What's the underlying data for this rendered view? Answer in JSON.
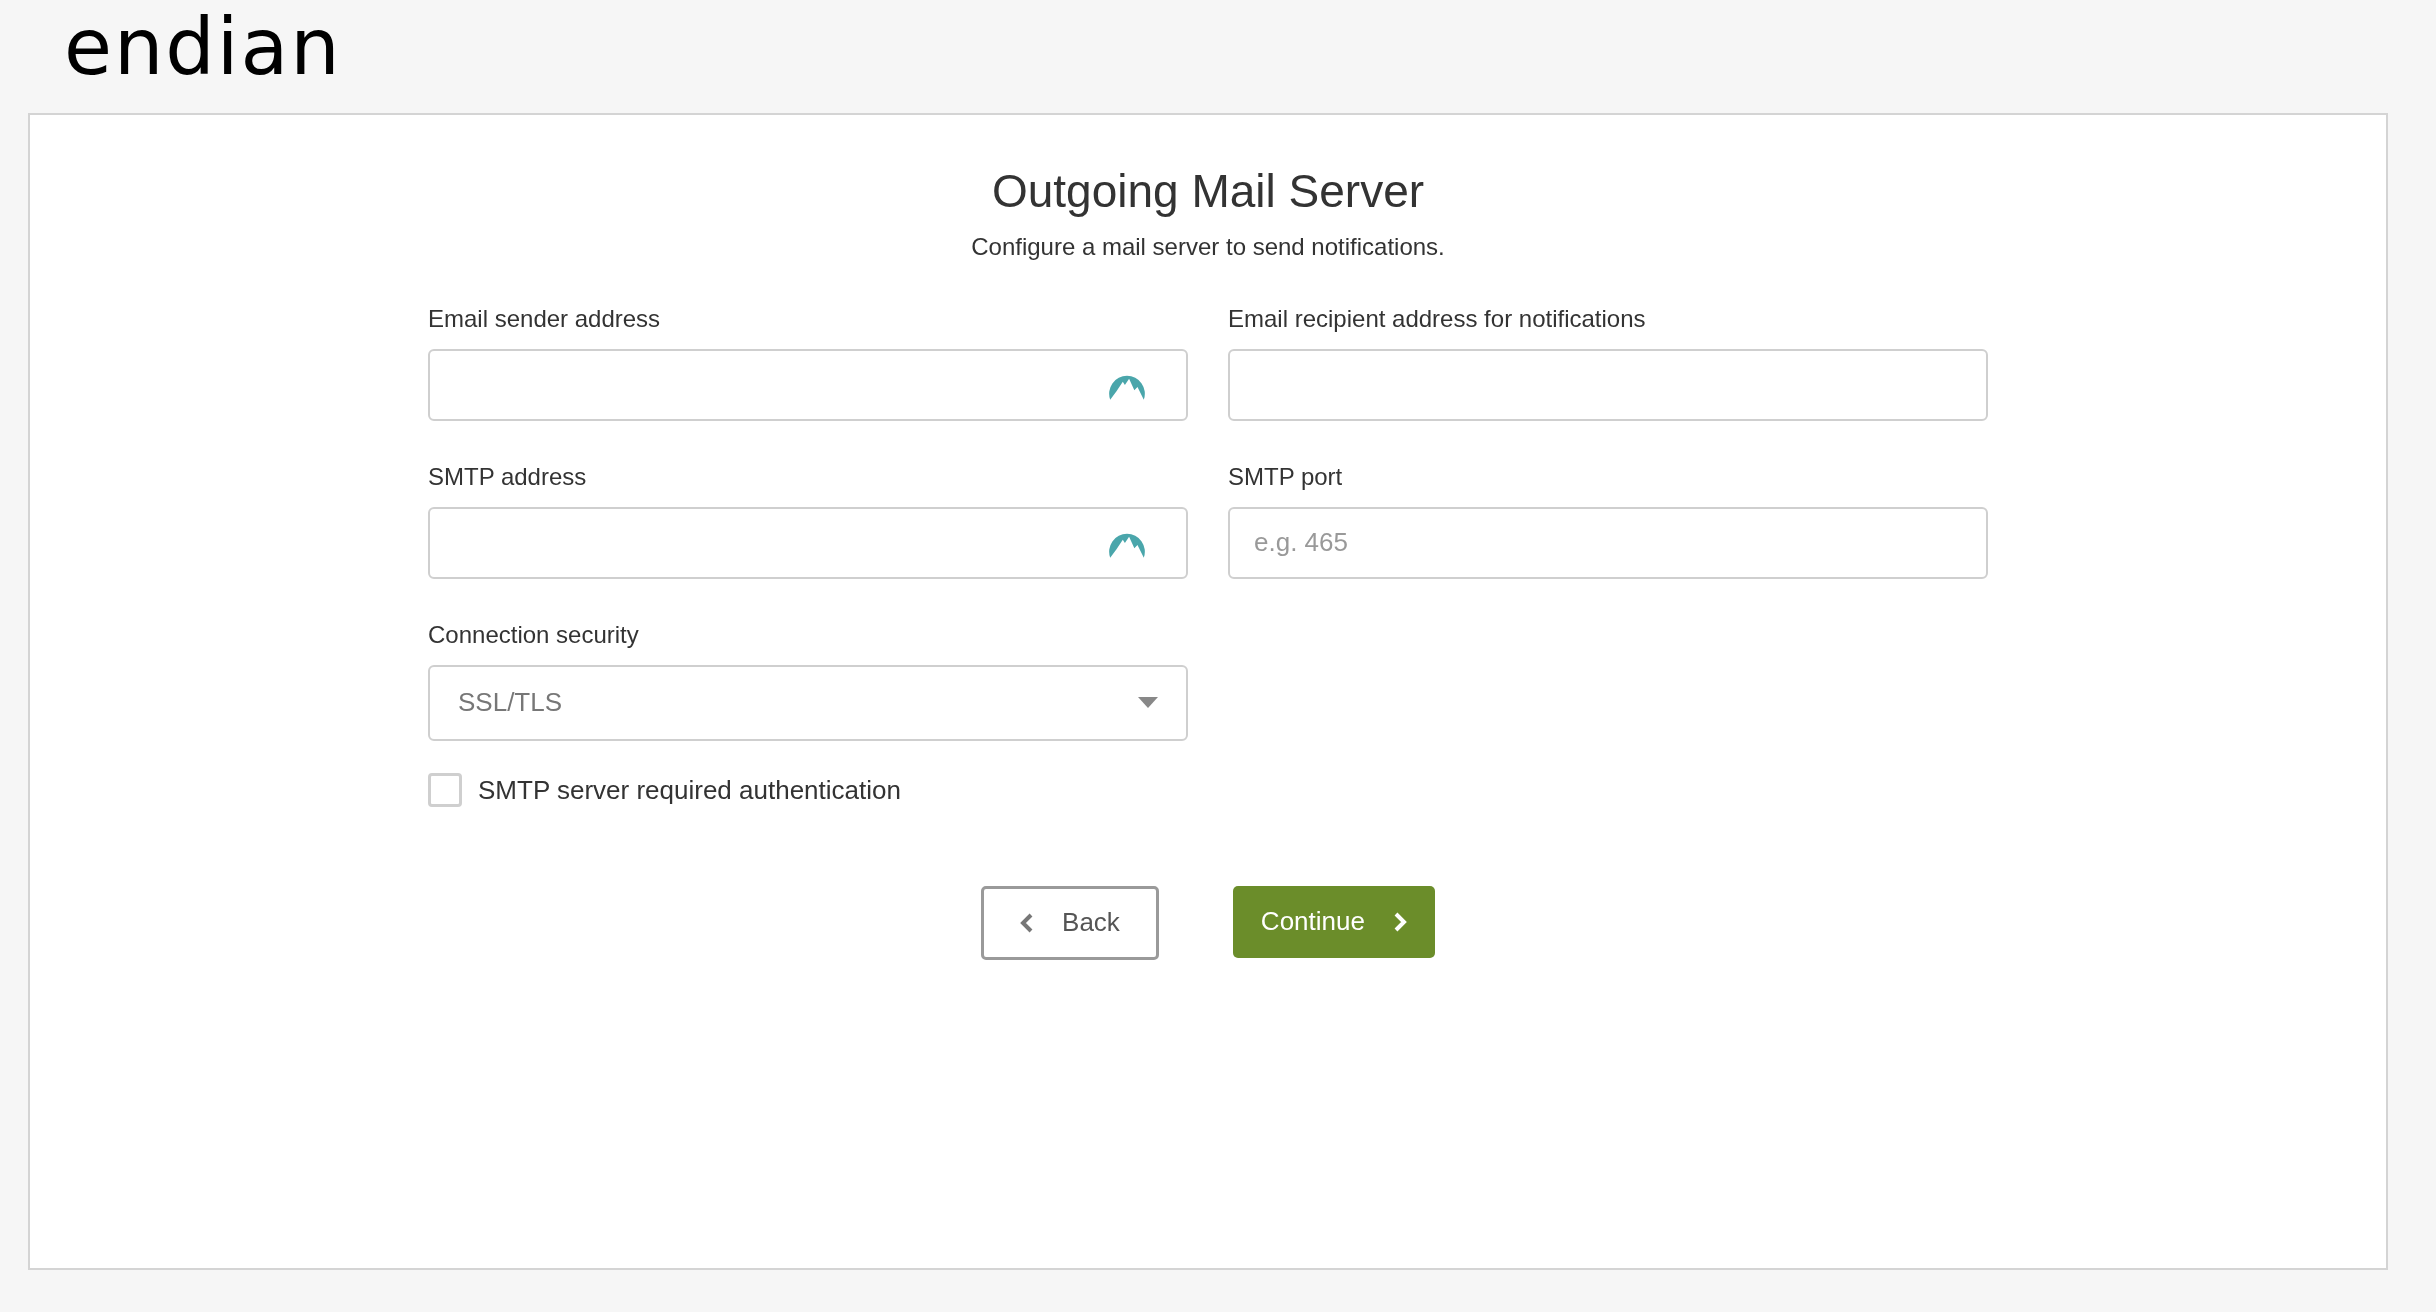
{
  "logo": {
    "text": "endian"
  },
  "title": "Outgoing Mail Server",
  "subtitle": "Configure a mail server to send notifications.",
  "fields": [
    {
      "kind": "text",
      "label": "Email sender address",
      "value_icon": true
    },
    {
      "kind": "text",
      "label": "Email recipient address for notifications",
      "value_icon": false
    },
    {
      "kind": "text",
      "label": "SMTP address",
      "value_icon": true
    },
    {
      "kind": "text",
      "label": "SMTP port",
      "placeholder": "e.g. 465",
      "value_icon": false
    },
    {
      "kind": "select",
      "label": "Connection security",
      "value": "SSL/TLS"
    }
  ],
  "checkbox": {
    "label": "SMTP server required authentication",
    "checked": false
  },
  "buttons": [
    {
      "kind": "back",
      "label": "Back"
    },
    {
      "kind": "continue",
      "label": "Continue"
    }
  ]
}
